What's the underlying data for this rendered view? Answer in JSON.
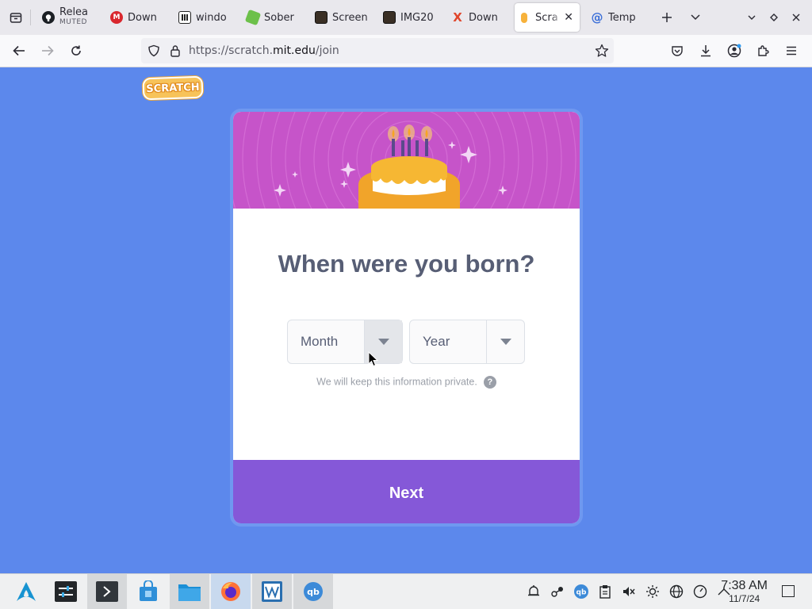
{
  "browser": {
    "tabs": [
      {
        "label": "Relea",
        "sub": "MUTED",
        "icon": "github-icon"
      },
      {
        "label": "Down",
        "icon": "mega-icon"
      },
      {
        "label": "windo",
        "icon": "archive-icon"
      },
      {
        "label": "Sober",
        "icon": "sober-icon"
      },
      {
        "label": "Screen",
        "icon": "image-icon"
      },
      {
        "label": "IMG20",
        "icon": "image-icon"
      },
      {
        "label": "Down",
        "icon": "x-icon"
      },
      {
        "label": "Scra",
        "icon": "scratch-icon",
        "active": true
      },
      {
        "label": "Temp",
        "icon": "at-icon"
      }
    ],
    "url": {
      "prefix": "https://scratch.",
      "host": "mit.edu",
      "path": "/join"
    }
  },
  "page": {
    "logo_text": "SCRATCH",
    "title": "When were you born?",
    "month": {
      "value": "Month"
    },
    "year": {
      "value": "Year"
    },
    "privacy_note": "We will keep this information private.",
    "help_glyph": "?",
    "next_label": "Next"
  },
  "taskbar": {
    "time": "7:38 AM",
    "date": "11/7/24"
  },
  "colors": {
    "page_bg": "#5c88ec",
    "banner": "#c654c9",
    "next_button": "#8558d8",
    "title_text": "#575e75"
  }
}
